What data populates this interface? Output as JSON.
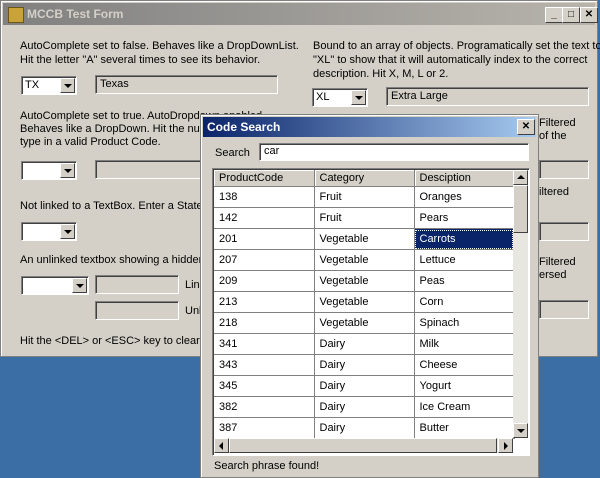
{
  "main_window": {
    "title": "MCCB Test Form",
    "controls": {
      "minimize": "_",
      "maximize": "□",
      "close": "✕"
    },
    "section1": {
      "desc_line1": "AutoComplete set to false. Behaves like a DropDownList.",
      "desc_line2": "Hit the letter \"A\" several times to see its behavior.",
      "combo_value": "TX",
      "text_value": "Texas"
    },
    "section2": {
      "desc_line1": "AutoComplete set to true. AutoDropdown enabled.",
      "desc_line2": "Behaves like a DropDown. Hit the number",
      "desc_line3": "type in a valid Product Code.",
      "combo_value": ""
    },
    "section3": {
      "desc_line1": "Not linked to a TextBox. Enter a State A",
      "combo_value": ""
    },
    "section4": {
      "desc_line1": "An unlinked textbox showing a hidden co",
      "label1": "Link",
      "label2": "Unl",
      "combo_value": ""
    },
    "footer_note": "Hit the <DEL> or <ESC> key to clear a C",
    "right_section1": {
      "desc_line1": "Bound to an array of objects. Programatically set the text to",
      "desc_line2": "\"XL\" to show that it will automatically index to the correct",
      "desc_line3": "description. Hit X, M, L or 2.",
      "combo_value": "XL",
      "text_value": "Extra Large"
    },
    "right_fragments": {
      "a1": "Filtered",
      "a2": "of the",
      "b1": "iltered",
      "c1": "Filtered",
      "c2": "ersed"
    }
  },
  "dialog": {
    "title": "Code Search",
    "close": "✕",
    "search_label": "Search",
    "search_value": "car",
    "columns": [
      "ProductCode",
      "Category",
      "Desciption"
    ],
    "rows": [
      [
        "138",
        "Fruit",
        "Oranges"
      ],
      [
        "142",
        "Fruit",
        "Pears"
      ],
      [
        "201",
        "Vegetable",
        "Carrots"
      ],
      [
        "207",
        "Vegetable",
        "Lettuce"
      ],
      [
        "209",
        "Vegetable",
        "Peas"
      ],
      [
        "213",
        "Vegetable",
        "Corn"
      ],
      [
        "218",
        "Vegetable",
        "Spinach"
      ],
      [
        "341",
        "Dairy",
        "Milk"
      ],
      [
        "343",
        "Dairy",
        "Cheese"
      ],
      [
        "345",
        "Dairy",
        "Yogurt"
      ],
      [
        "382",
        "Dairy",
        "Ice Cream"
      ],
      [
        "387",
        "Dairy",
        "Butter"
      ]
    ],
    "selected_row": 2,
    "status": "Search phrase found!",
    "colors": {
      "selection": "#0a246a",
      "titlebar": "#0a246a"
    }
  }
}
